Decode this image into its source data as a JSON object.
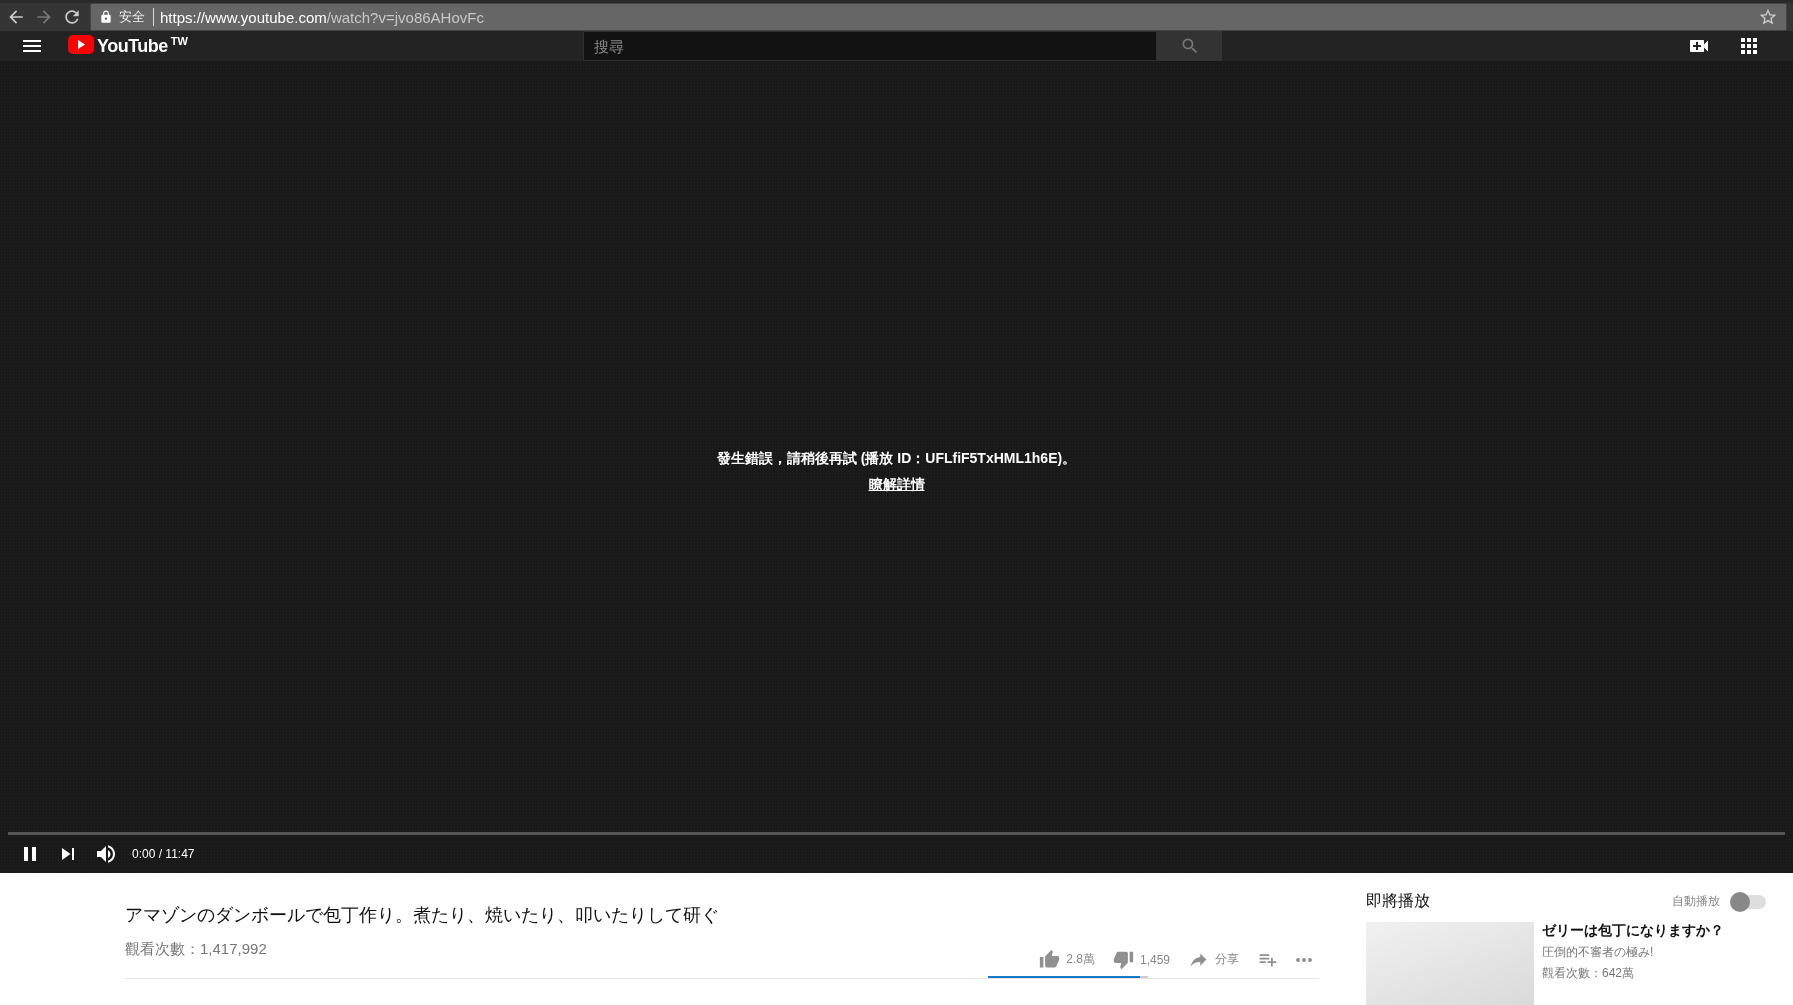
{
  "browser": {
    "secure_label": "安全",
    "url_host": "https://www.youtube.com",
    "url_path": "/watch?v=jvo86AHovFc"
  },
  "header": {
    "logo_text": "YouTube",
    "region": "TW",
    "search_placeholder": "搜尋"
  },
  "player": {
    "error_message": "發生錯誤，請稍後再試 (播放 ID：UFLfiF5TxHML1h6E)。",
    "error_link": "瞭解詳情",
    "playing": true,
    "progress": {
      "level": 0
    },
    "time": "0:00 / 11:47"
  },
  "video": {
    "title": "アマゾンのダンボールで包丁作り。煮たり、焼いたり、叩いたりして研ぐ",
    "views": "觀看次數：1,417,992"
  },
  "actions": [
    {
      "kind": "like",
      "label": "2.8萬"
    },
    {
      "kind": "dislike",
      "label": "1,459"
    },
    {
      "kind": "share",
      "label": "分享"
    },
    {
      "kind": "add"
    },
    {
      "kind": "more"
    }
  ],
  "sentiment": {
    "level": 0.95
  },
  "up_next": {
    "heading": "即將播放",
    "autoplay_label": "自動播放",
    "autoplay_on": false,
    "items": [
      {
        "title": "ゼリーは包丁になりますか？",
        "channel": "圧倒的不審者の極み!",
        "views": "觀看次數：642萬"
      }
    ]
  }
}
